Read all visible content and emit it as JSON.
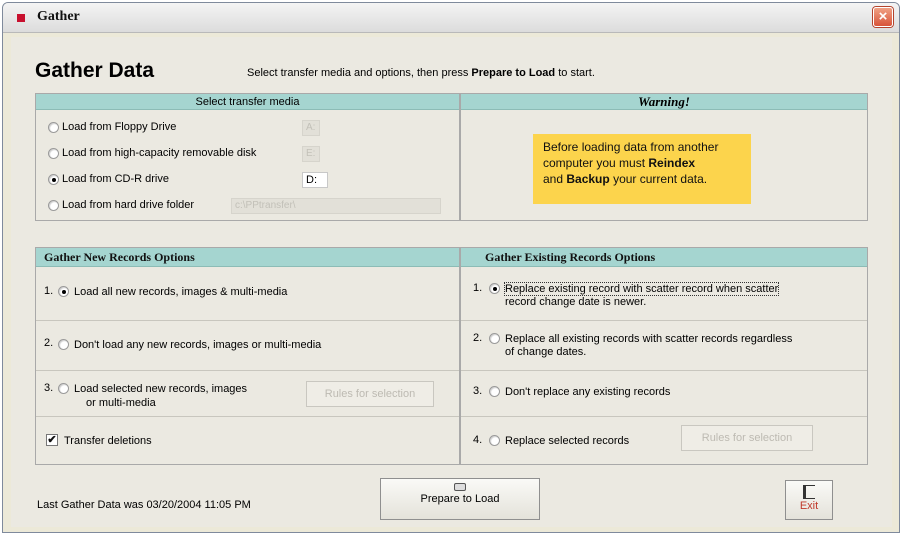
{
  "window": {
    "title": "Gather",
    "close_label": "×"
  },
  "heading": "Gather Data",
  "instructions": {
    "before": "Select transfer media and options, then press ",
    "bold": "Prepare to Load",
    "after": " to start."
  },
  "media": {
    "header": "Select transfer media",
    "options": [
      {
        "label": "Load from Floppy Drive",
        "value": "A:",
        "selected": false,
        "enabled": false
      },
      {
        "label": "Load from high-capacity removable disk",
        "value": "E:",
        "selected": false,
        "enabled": false
      },
      {
        "label": "Load from CD-R drive",
        "value": "D:",
        "selected": true,
        "enabled": true
      },
      {
        "label": "Load from hard drive folder",
        "value": "c:\\PPtransfer\\",
        "selected": false,
        "enabled": false
      }
    ]
  },
  "warning": {
    "header": "Warning!",
    "line1": "Before loading data from another",
    "line2_prefix": "computer you must ",
    "line2_bold": "Reindex",
    "line3_prefix": "and ",
    "line3_bold": "Backup",
    "line3_suffix": "your current data."
  },
  "new_records": {
    "header": "Gather New Records Options",
    "options": [
      {
        "num": "1.",
        "line1": "Load all new records, images & multi-media",
        "line2": "",
        "selected": true
      },
      {
        "num": "2.",
        "line1": "Don't load any new records, images or multi-media",
        "line2": "",
        "selected": false
      },
      {
        "num": "3.",
        "line1": "Load selected new records, images",
        "line2": "or multi-media",
        "selected": false
      }
    ],
    "rules_button": "Rules for selection",
    "transfer_deletions": {
      "label": "Transfer deletions",
      "checked": true
    }
  },
  "existing_records": {
    "header": "Gather Existing Records Options",
    "options": [
      {
        "num": "1.",
        "line1": "Replace existing record with scatter record when scatter",
        "line2": "record change date is newer.",
        "selected": true
      },
      {
        "num": "2.",
        "line1": "Replace all existing records with scatter records regardless",
        "line2": "of change dates.",
        "selected": false
      },
      {
        "num": "3.",
        "line1": "Don't replace any existing records",
        "line2": "",
        "selected": false
      },
      {
        "num": "4.",
        "line1": "Replace selected records",
        "line2": "",
        "selected": false
      }
    ],
    "rules_button": "Rules for selection"
  },
  "footer": {
    "last_gather": "Last Gather Data was  03/20/2004 11:05 PM",
    "prepare_button": "Prepare to Load",
    "exit_button": "Exit"
  },
  "colors": {
    "header_teal": "#a5d5d0",
    "warning_yellow": "#fcd44c",
    "close_red": "#d8543a"
  },
  "icons": [
    "window-app-icon",
    "close-icon",
    "drive-icon",
    "exit-door-icon"
  ]
}
